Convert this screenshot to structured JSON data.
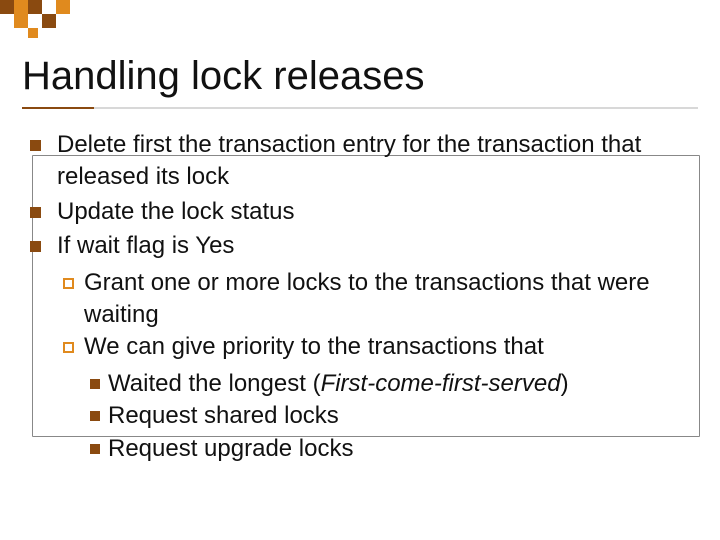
{
  "title": "Handling lock releases",
  "bullets": {
    "b1": "Delete first the transaction entry for the transaction that released its lock",
    "b2": "Update the lock status",
    "b3": "If wait flag is Yes",
    "b3a": "Grant one or more locks to the transactions that were waiting",
    "b3b": "We can give priority to the transactions that",
    "b3b1_a": "Waited the longest (",
    "b3b1_b": "First-come-first-served",
    "b3b1_c": ")",
    "b3b2": "Request shared locks",
    "b3b3": "Request upgrade locks"
  }
}
